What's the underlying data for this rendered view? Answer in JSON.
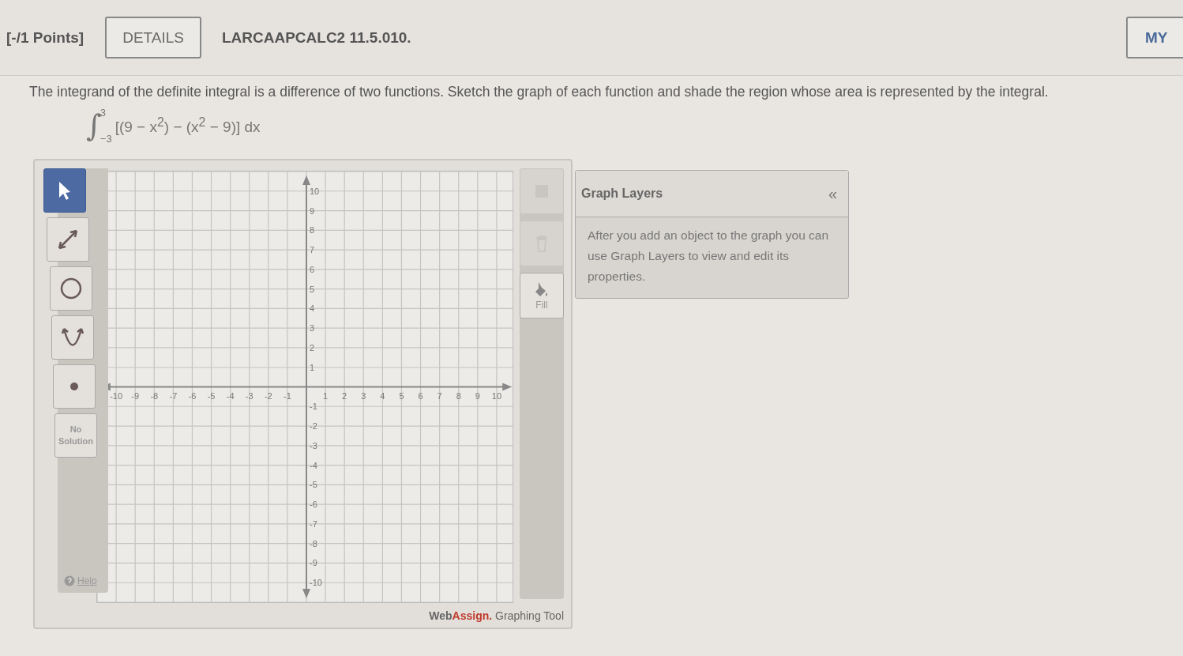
{
  "header": {
    "points": "[-/1 Points]",
    "details_button": "DETAILS",
    "problem_code": "LARCAAPCALC2 11.5.010.",
    "right_button": "MY"
  },
  "question": {
    "text": "The integrand of the definite integral is a difference of two functions. Sketch the graph of each function and shade the region whose area is represented by the integral.",
    "integral": {
      "sign": "∫",
      "upper": "3",
      "lower": "−3",
      "integrand": "[(9 − x$^{2}$) − (x$^{2}$ − 9)] dx"
    }
  },
  "graph_tool": {
    "tools": [
      {
        "kind": "pointer",
        "selected": true
      },
      {
        "kind": "line",
        "selected": false
      },
      {
        "kind": "circle",
        "selected": false
      },
      {
        "kind": "parabola",
        "selected": false
      },
      {
        "kind": "point",
        "selected": false
      },
      {
        "kind": "text",
        "label": "No Solution",
        "selected": false
      }
    ],
    "help": "Help",
    "x_ticks": [
      "-10",
      "-9",
      "-8",
      "-7",
      "-6",
      "-5",
      "-4",
      "-3",
      "-2",
      "-1",
      "1",
      "2",
      "3",
      "4",
      "5",
      "6",
      "7",
      "8",
      "9",
      "10"
    ],
    "y_ticks": [
      "10",
      "9",
      "8",
      "7",
      "6",
      "5",
      "4",
      "3",
      "2",
      "1",
      "-1",
      "-2",
      "-3",
      "-4",
      "-5",
      "-6",
      "-7",
      "-8",
      "-9",
      "-10"
    ],
    "actions": [
      {
        "kind": "color",
        "disabled": true
      },
      {
        "kind": "delete",
        "disabled": true
      },
      {
        "kind": "fill",
        "label": "Fill",
        "disabled": false
      }
    ],
    "footer": {
      "brand_first": "Web",
      "brand_second": "Assign.",
      "text": "Graphing Tool"
    }
  },
  "graph_layers": {
    "title": "Graph Layers",
    "collapse": "«",
    "text": "After you add an object to the graph you can use Graph Layers to view and edit its properties."
  }
}
